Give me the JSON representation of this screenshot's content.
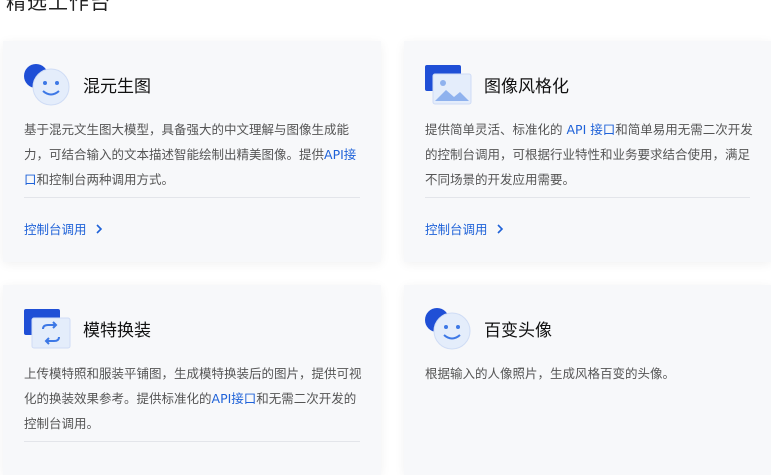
{
  "section": {
    "title": "精选工作台"
  },
  "cards": [
    {
      "title": "混元生图",
      "icon": "face-bubble-icon",
      "desc": [
        {
          "t": "基于混元文生图大模型，具备强大的中文理解与图像生成能力，可结合输入的文本描述智能绘制出精美图像。提供"
        },
        {
          "t": "API接口",
          "hl": true
        },
        {
          "t": "和控制台两种调用方式。"
        }
      ],
      "link": "控制台调用"
    },
    {
      "title": "图像风格化",
      "icon": "picture-frame-icon",
      "desc": [
        {
          "t": "提供简单灵活、标准化的 "
        },
        {
          "t": "API 接口",
          "hl": true
        },
        {
          "t": "和简单易用无需二次开发的控制台调用，可根据行业特性和业务要求结合使用，满足不同场景的开发应用需要。"
        }
      ],
      "link": "控制台调用"
    },
    {
      "title": "模特换装",
      "icon": "swap-arrows-icon",
      "desc": [
        {
          "t": "上传模特照和服装平铺图，生成模特换装后的图片，提供可视化的换装效果参考。提供标准化的"
        },
        {
          "t": "API接口",
          "hl": true
        },
        {
          "t": "和无需二次开发的控制台调用。"
        }
      ],
      "link": ""
    },
    {
      "title": "百变头像",
      "icon": "face-bubble-icon",
      "desc": [
        {
          "t": "根据输入的人像照片，生成风格百变的头像。"
        }
      ],
      "link": ""
    }
  ],
  "colors": {
    "accent": "#1f62d8",
    "card_bg": "#f7f8fa"
  }
}
